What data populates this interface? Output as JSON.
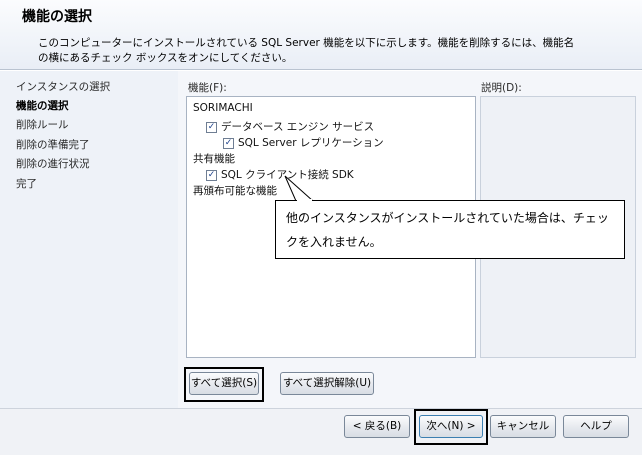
{
  "header": {
    "title": "機能の選択",
    "description": "このコンピューターにインストールされている SQL Server 機能を以下に示します。機能を削除するには、機能名の横にあるチェック ボックスをオンにしてください。"
  },
  "nav": {
    "items": [
      {
        "label": "インスタンスの選択",
        "active": false
      },
      {
        "label": "機能の選択",
        "active": true
      },
      {
        "label": "削除ルール",
        "active": false
      },
      {
        "label": "削除の準備完了",
        "active": false
      },
      {
        "label": "削除の進行状況",
        "active": false
      },
      {
        "label": "完了",
        "active": false
      }
    ]
  },
  "main": {
    "features_label": "機能(F):",
    "description_label": "説明(D):",
    "tree": [
      {
        "label": "SORIMACHI",
        "checkbox": false
      },
      {
        "label": "データベース エンジン サービス",
        "checkbox": true,
        "checked": true
      },
      {
        "label": "SQL Server レプリケーション",
        "checkbox": true,
        "checked": true
      },
      {
        "label": "共有機能",
        "checkbox": false
      },
      {
        "label": "SQL クライアント接続 SDK",
        "checkbox": true,
        "checked": true
      },
      {
        "label": "再頒布可能な機能",
        "checkbox": false
      }
    ],
    "select_all_label": "すべて選択(S)",
    "unselect_all_label": "すべて選択解除(U)"
  },
  "footer": {
    "back_label": "< 戻る(B)",
    "next_label": "次へ(N) >",
    "cancel_label": "キャンセル",
    "help_label": "ヘルプ"
  },
  "callout": {
    "text": "他のインスタンスがインストールされていた場合は、チェックを入れません。"
  },
  "colors": {
    "header_bg": "#e9eef6",
    "nav_bg": "#eef2f8",
    "check_color": "#1a3f8a"
  }
}
